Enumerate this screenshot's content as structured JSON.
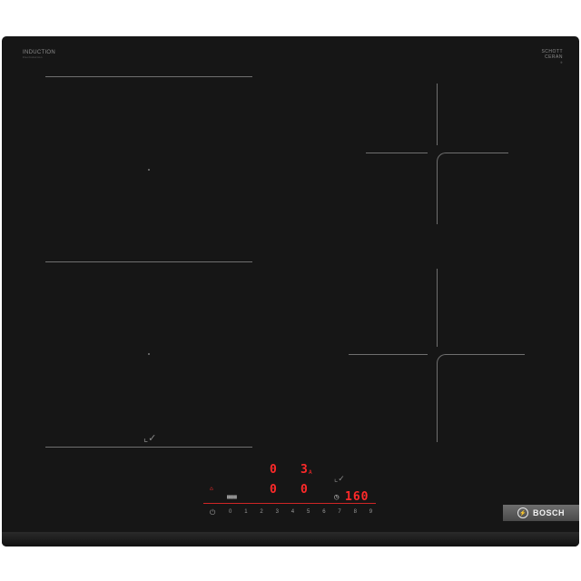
{
  "hob": {
    "brand_top_left": "INDUCTION",
    "brand_top_left_sub": "FlexInduction",
    "brand_top_right_line1": "SCHOTT",
    "brand_top_right_line2": "CERAN",
    "brand_top_right_sub": "®"
  },
  "controls": {
    "zone_display_1": "0",
    "zone_display_2": "3",
    "zone_display_2_suffix": "A",
    "zone_display_3": "0",
    "zone_display_4": "0",
    "timer_display": "160",
    "timer_icon": "clock-icon",
    "slider_numbers": [
      "0",
      "1",
      "2",
      "3",
      "4",
      "5",
      "6",
      "7",
      "8",
      "9"
    ],
    "power_icon": "power-icon"
  },
  "logo": {
    "text": "BOSCH"
  },
  "colors": {
    "panel": "#161616",
    "display_red": "#ff2a2a",
    "lines": "#6f6f6f"
  }
}
